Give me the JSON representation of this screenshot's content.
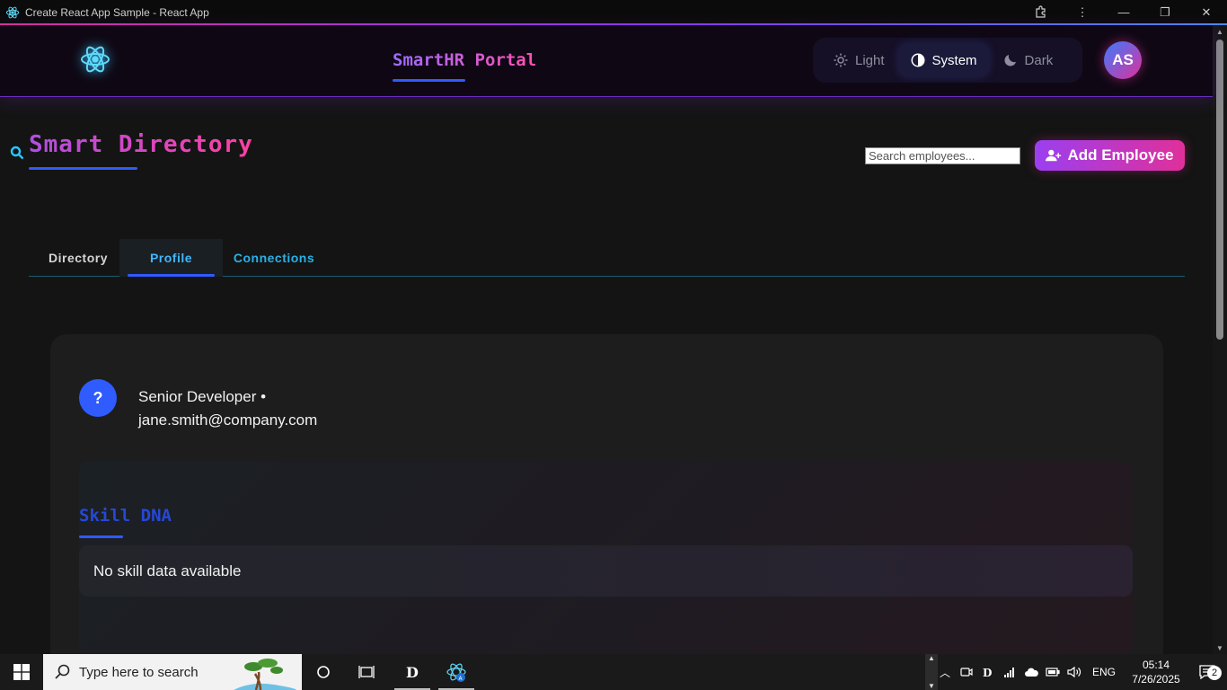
{
  "window": {
    "title": "Create React App Sample - React App"
  },
  "header": {
    "brand": "SmartHR Portal",
    "theme_options": [
      {
        "label": "Light",
        "icon": "sun-icon"
      },
      {
        "label": "System",
        "icon": "half-circle-icon"
      },
      {
        "label": "Dark",
        "icon": "moon-icon"
      }
    ],
    "active_theme": "System",
    "avatar_initials": "AS"
  },
  "page": {
    "title": "Smart Directory",
    "search_placeholder": "Search employees...",
    "add_button_label": "Add Employee"
  },
  "tabs": [
    {
      "label": "Directory"
    },
    {
      "label": "Profile"
    },
    {
      "label": "Connections"
    }
  ],
  "active_tab": "Profile",
  "profile": {
    "avatar_glyph": "?",
    "role_line": "Senior Developer •",
    "email": "jane.smith@company.com",
    "skill_section_title": "Skill DNA",
    "skill_empty_message": "No skill data available"
  },
  "taskbar": {
    "search_placeholder": "Type here to search",
    "language": "ENG",
    "time": "05:14",
    "date": "7/26/2025",
    "notification_count": "2"
  },
  "colors": {
    "accent_blue": "#2f5bff",
    "accent_pink": "#e0309a",
    "accent_purple": "#9b3ff0",
    "tab_cyan": "#3fb6ff",
    "react_cyan": "#61dafb"
  }
}
